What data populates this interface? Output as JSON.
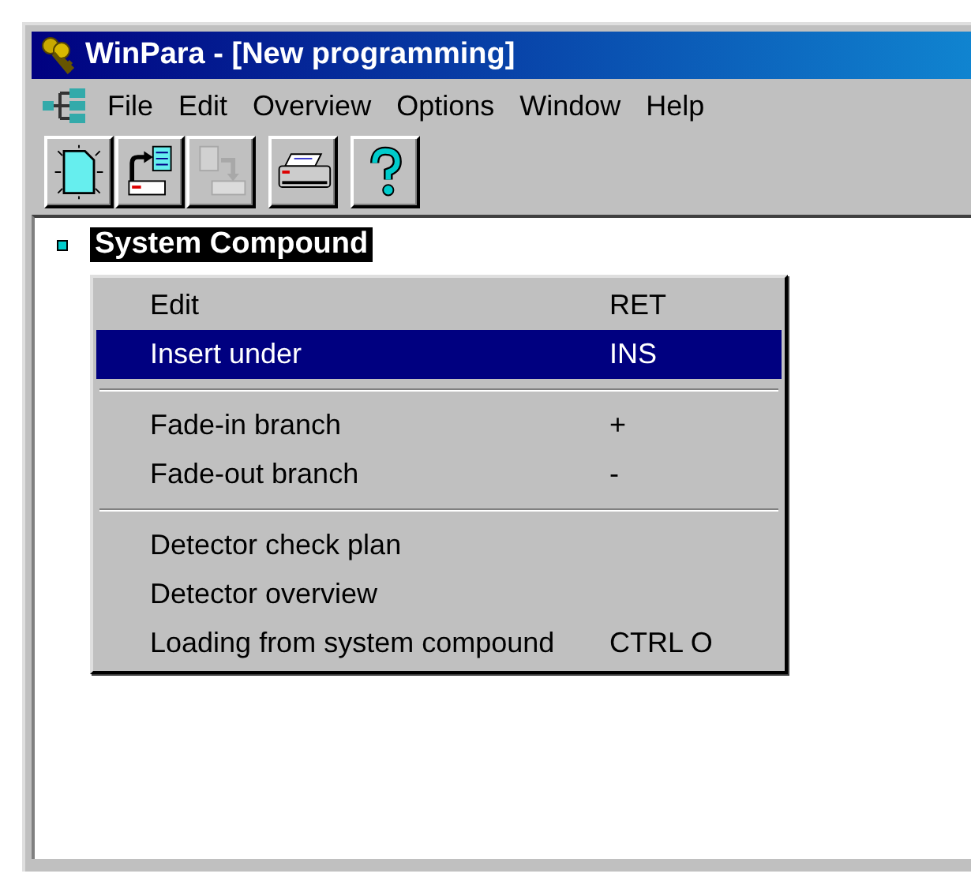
{
  "window": {
    "title": "WinPara - [New programming]"
  },
  "menu_bar": [
    {
      "label": "File"
    },
    {
      "label": "Edit"
    },
    {
      "label": "Overview"
    },
    {
      "label": "Options"
    },
    {
      "label": "Window"
    },
    {
      "label": "Help"
    }
  ],
  "toolbar": [
    {
      "buttons": [
        {
          "kind": "new",
          "disabled": false
        },
        {
          "kind": "export",
          "disabled": false
        },
        {
          "kind": "import",
          "disabled": true
        }
      ]
    },
    {
      "buttons": [
        {
          "kind": "print",
          "disabled": false
        }
      ]
    },
    {
      "buttons": [
        {
          "kind": "help",
          "disabled": false
        }
      ]
    }
  ],
  "tree": [
    {
      "label": "System Compound",
      "selected": true
    }
  ],
  "context_menu": [
    {
      "kind": "item",
      "label": "Edit",
      "shortcut": "RET",
      "selected": false
    },
    {
      "kind": "item",
      "label": "Insert under",
      "shortcut": "INS",
      "selected": true
    },
    {
      "kind": "separator"
    },
    {
      "kind": "item",
      "label": "Fade-in branch",
      "shortcut": "+",
      "selected": false
    },
    {
      "kind": "item",
      "label": "Fade-out branch",
      "shortcut": "-",
      "selected": false
    },
    {
      "kind": "separator"
    },
    {
      "kind": "item",
      "label": "Detector check plan",
      "selected": false
    },
    {
      "kind": "item",
      "label": "Detector overview",
      "selected": false
    },
    {
      "kind": "item",
      "label": "Loading from system compound",
      "shortcut": "CTRL O",
      "selected": false
    }
  ]
}
